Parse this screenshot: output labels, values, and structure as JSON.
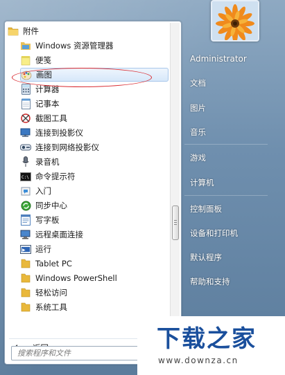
{
  "accessories_folder": "附件",
  "items": [
    {
      "label": "Windows 资源管理器",
      "icon": "explorer-icon"
    },
    {
      "label": "便笺",
      "icon": "sticky-notes-icon"
    },
    {
      "label": "画图",
      "icon": "paint-icon"
    },
    {
      "label": "计算器",
      "icon": "calculator-icon"
    },
    {
      "label": "记事本",
      "icon": "notepad-icon"
    },
    {
      "label": "截图工具",
      "icon": "snipping-tool-icon"
    },
    {
      "label": "连接到投影仪",
      "icon": "projector-icon"
    },
    {
      "label": "连接到网络投影仪",
      "icon": "network-projector-icon"
    },
    {
      "label": "录音机",
      "icon": "microphone-icon"
    },
    {
      "label": "命令提示符",
      "icon": "cmd-icon"
    },
    {
      "label": "入门",
      "icon": "getting-started-icon"
    },
    {
      "label": "同步中心",
      "icon": "sync-icon"
    },
    {
      "label": "写字板",
      "icon": "wordpad-icon"
    },
    {
      "label": "远程桌面连接",
      "icon": "remote-desktop-icon"
    },
    {
      "label": "运行",
      "icon": "run-icon"
    }
  ],
  "folders": [
    {
      "label": "Tablet PC",
      "icon": "folder-icon"
    },
    {
      "label": "Windows PowerShell",
      "icon": "folder-icon"
    },
    {
      "label": "轻松访问",
      "icon": "folder-icon"
    },
    {
      "label": "系统工具",
      "icon": "folder-icon"
    }
  ],
  "back_label": "返回",
  "search_placeholder": "搜索程序和文件",
  "right_menu": {
    "username": "Administrator",
    "items": [
      "文档",
      "图片",
      "音乐",
      "游戏",
      "计算机",
      "控制面板",
      "设备和打印机",
      "默认程序",
      "帮助和支持"
    ]
  },
  "watermark": {
    "logo": "下载之家",
    "url": "www.downza.cn"
  },
  "colors": {
    "highlight_ellipse": "#d9292f",
    "watermark_blue": "#1a4f9c"
  }
}
